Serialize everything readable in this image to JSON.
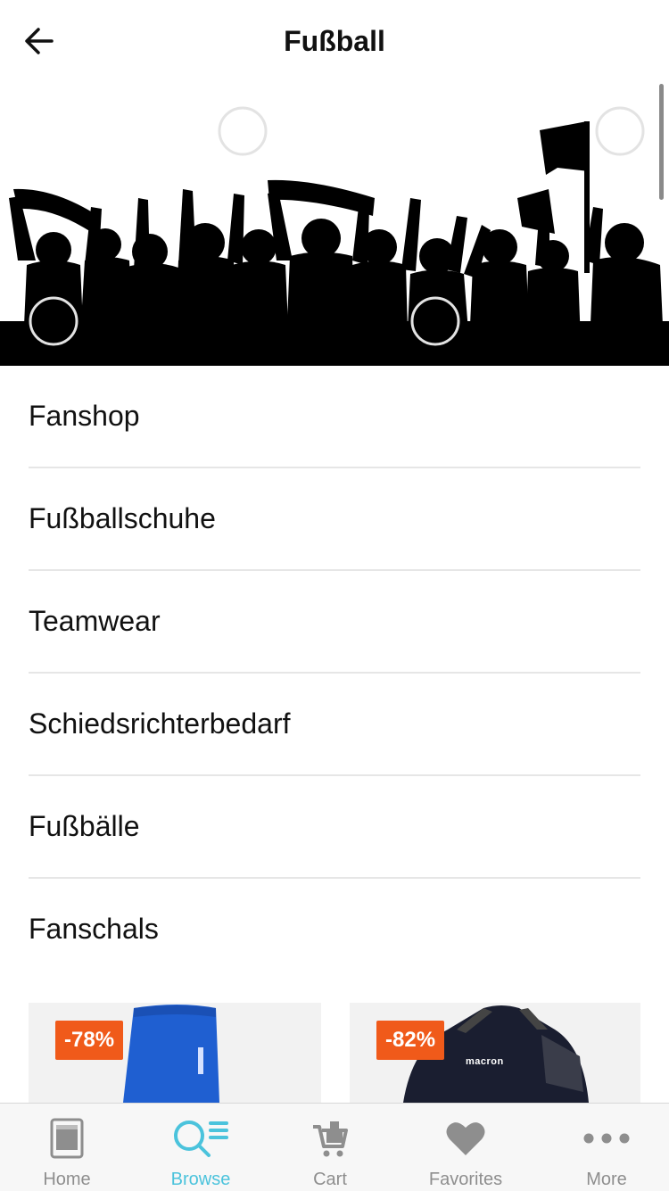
{
  "header": {
    "title": "Fußball"
  },
  "categories": [
    {
      "label": "Fanshop"
    },
    {
      "label": "Fußballschuhe"
    },
    {
      "label": "Teamwear"
    },
    {
      "label": "Schiedsrichterbedarf"
    },
    {
      "label": "Fußbälle"
    },
    {
      "label": "Fanschals"
    }
  ],
  "products": [
    {
      "discount": "-78%"
    },
    {
      "discount": "-82%",
      "brand": "macron"
    }
  ],
  "tabbar": {
    "active": "Browse",
    "active_color": "#4bc3dc",
    "inactive_color": "#8e8e8e",
    "tabs": [
      {
        "label": "Home",
        "icon": "tablet-icon"
      },
      {
        "label": "Browse",
        "icon": "search-list-icon"
      },
      {
        "label": "Cart",
        "icon": "cart-icon"
      },
      {
        "label": "Favorites",
        "icon": "heart-icon"
      },
      {
        "label": "More",
        "icon": "more-icon"
      }
    ]
  }
}
